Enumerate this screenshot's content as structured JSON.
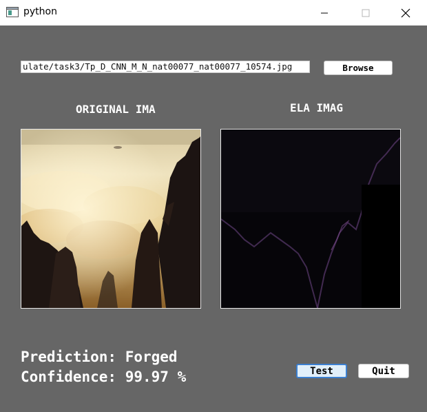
{
  "window": {
    "title": "python",
    "app_icon": "python-window-icon",
    "controls": [
      "minimize-icon",
      "maximize-icon",
      "close-icon"
    ]
  },
  "file_picker": {
    "path_value": "ulate/task3/Tp_D_CNN_M_N_nat00077_nat00077_10574.jpg",
    "browse_label": "Browse"
  },
  "images": {
    "original_label": "ORIGINAL IMA",
    "ela_label": "ELA IMAG"
  },
  "result": {
    "prediction": "Prediction: Forged",
    "confidence": "Confidence: 99.97 %"
  },
  "actions": {
    "test_label": "Test",
    "quit_label": "Quit"
  },
  "colors": {
    "background": "#666666",
    "text": "#ffffff",
    "test_focus_border": "#3b7fd0"
  }
}
